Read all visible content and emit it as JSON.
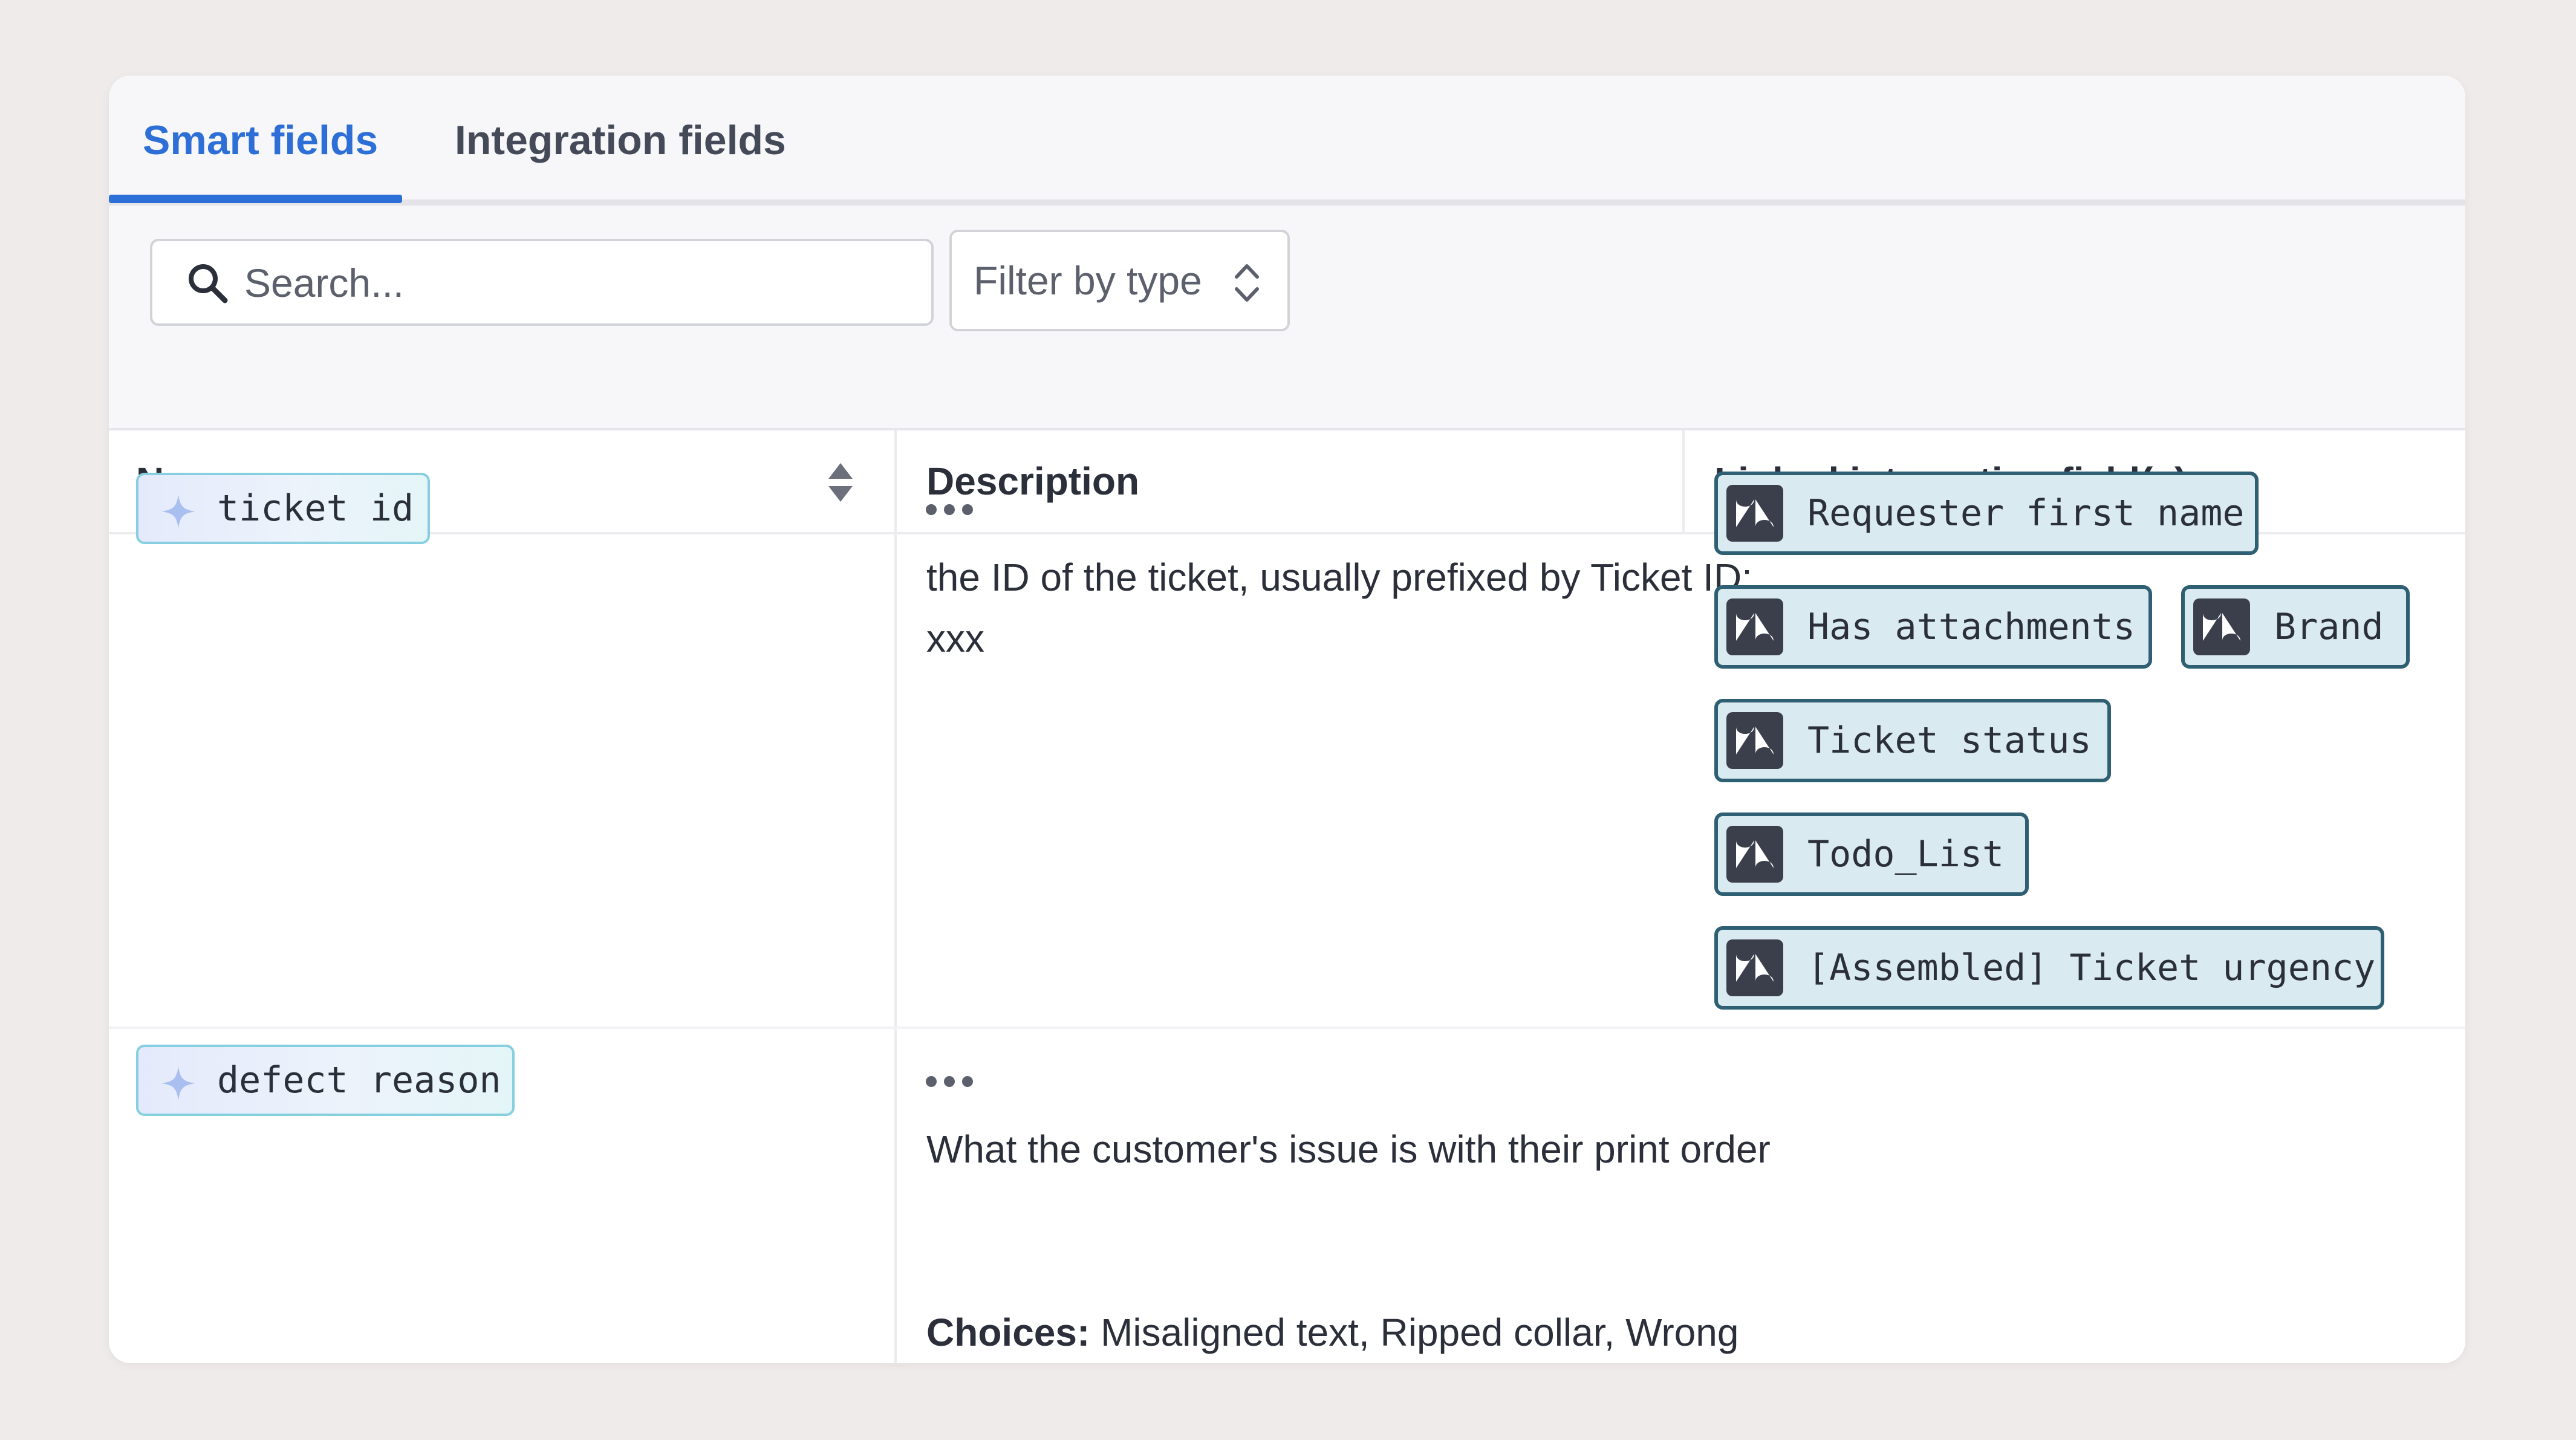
{
  "tabs": [
    {
      "label": "Smart fields",
      "active": true
    },
    {
      "label": "Integration fields",
      "active": false
    }
  ],
  "search": {
    "placeholder": "Search..."
  },
  "filter": {
    "label": "Filter by type"
  },
  "table": {
    "headers": {
      "name": "Name",
      "description": "Description",
      "linked": "Linked integration field(s)"
    },
    "rows": [
      {
        "name": "ticket id",
        "description": "the ID of the ticket, usually prefixed by Ticket ID: xxx",
        "linked_fields": [
          "Requester first name",
          "Has attachments",
          "Brand",
          "Ticket status",
          "Todo_List",
          "[Assembled] Ticket urgency"
        ]
      },
      {
        "name": "defect reason",
        "description": "What the customer's issue is with their print order",
        "choices_label": "Choices:",
        "choices": "Misaligned text, Ripped collar, Wrong color",
        "linked_fields": []
      }
    ]
  },
  "colors": {
    "accent": "#2d6fd6",
    "chip_border": "#2e5f72",
    "chip_bg": "#daeaf1",
    "smart_chip_border": "#86cfe0"
  },
  "icons": {
    "search": "search-icon",
    "filter": "chevron-up-down-icon",
    "sort": "sort-icon",
    "smart_field": "sparkle-icon",
    "integration": "zendesk-logo-icon",
    "row_menu": "more-options-icon"
  }
}
